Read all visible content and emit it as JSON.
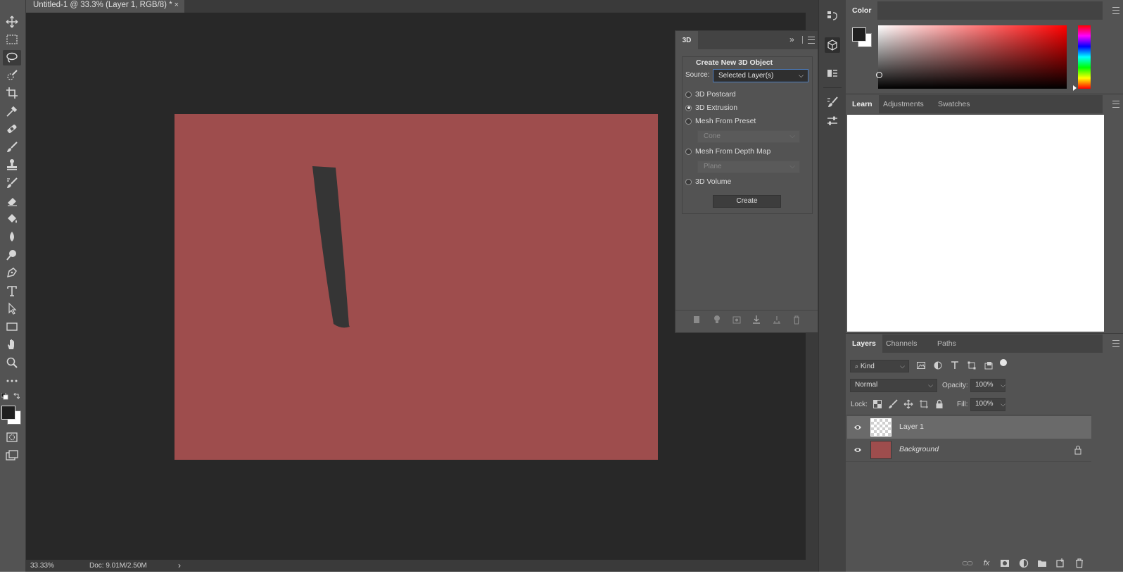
{
  "document": {
    "tab_title": "Untitled-1 @ 33.3% (Layer 1, RGB/8) *",
    "close_glyph": "×",
    "canvas_color": "#9e4d4d",
    "stroke_color": "#353535"
  },
  "status": {
    "zoom": "33.33%",
    "doc_size": "Doc: 9.01M/2.50M",
    "arrow": "›"
  },
  "toolbar": {
    "tools": [
      "move-tool-icon",
      "rectangular-marquee-icon",
      "lasso-icon",
      "quick-selection-icon",
      "crop-icon",
      "eyedropper-icon",
      "healing-brush-icon",
      "brush-icon",
      "clone-stamp-icon",
      "history-brush-icon",
      "eraser-icon",
      "paint-bucket-icon",
      "blur-icon",
      "dodge-icon",
      "pen-icon",
      "type-icon",
      "path-selection-icon",
      "rectangle-icon",
      "hand-icon",
      "zoom-icon",
      "more-tools-icon"
    ],
    "foreground": "#1f1f1f",
    "background": "#ffffff"
  },
  "panel3d": {
    "tab": "3D",
    "collapse_glyph": "»",
    "section_title": "Create New 3D Object",
    "source_label": "Source:",
    "source_value": "Selected Layer(s)",
    "options": [
      {
        "label": "3D Postcard",
        "selected": false
      },
      {
        "label": "3D Extrusion",
        "selected": true
      },
      {
        "label": "Mesh From Preset",
        "selected": false
      },
      {
        "label": "Mesh From Depth Map",
        "selected": false
      },
      {
        "label": "3D Volume",
        "selected": false
      }
    ],
    "preset_value": "Cone",
    "depthmap_value": "Plane",
    "create_label": "Create"
  },
  "color_panel": {
    "title": "Color",
    "hue": "#ff0000"
  },
  "learn_panel": {
    "tabs": [
      "Learn",
      "Adjustments",
      "Swatches"
    ]
  },
  "layers_panel": {
    "tabs": [
      "Layers",
      "Channels",
      "Paths"
    ],
    "filter_kind": "Kind",
    "blend_mode": "Normal",
    "opacity_label": "Opacity:",
    "opacity_value": "100%",
    "lock_label": "Lock:",
    "fill_label": "Fill:",
    "fill_value": "100%",
    "layers": [
      {
        "name": "Layer 1",
        "selected": true
      },
      {
        "name": "Background",
        "selected": false
      }
    ]
  }
}
